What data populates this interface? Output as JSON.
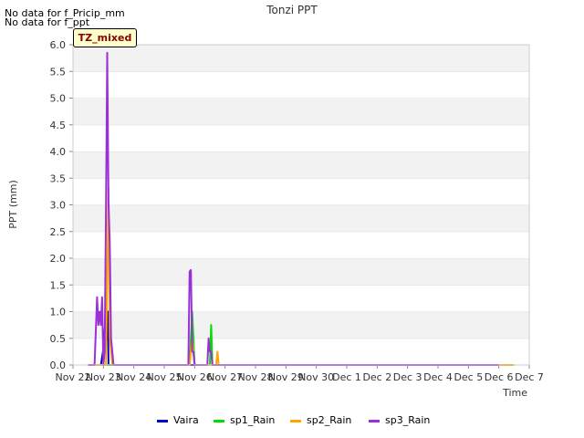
{
  "notes": [
    "No data for f_Pricip_mm",
    "No data for f_ppt"
  ],
  "tz_label": "TZ_mixed",
  "chart_data": {
    "type": "line",
    "title": "Tonzi PPT",
    "xlabel": "Time",
    "ylabel": "PPT (mm)",
    "ylim": [
      0,
      6.0
    ],
    "xlim": [
      "2021-11-22",
      "2021-12-07"
    ],
    "yticks": [
      "0.0",
      "0.5",
      "1.0",
      "1.5",
      "2.0",
      "2.5",
      "3.0",
      "3.5",
      "4.0",
      "4.5",
      "5.0",
      "5.5",
      "6.0"
    ],
    "xticks": [
      "Nov 22",
      "Nov 23",
      "Nov 24",
      "Nov 25",
      "Nov 26",
      "Nov 27",
      "Nov 28",
      "Nov 29",
      "Nov 30",
      "Dec 1",
      "Dec 2",
      "Dec 3",
      "Dec 4",
      "Dec 5",
      "Dec 6",
      "Dec 7"
    ],
    "grid": true,
    "legend_position": "bottom",
    "series": [
      {
        "name": "Vaira",
        "color": "#0000cc",
        "x": [
          "2021-11-22 12:00",
          "2021-11-22 22:00",
          "2021-11-23 00:00",
          "2021-11-23 02:00",
          "2021-11-23 03:00",
          "2021-11-23 03:30",
          "2021-11-23 04:00",
          "2021-11-23 06:00",
          "2021-12-06 00:00"
        ],
        "y": [
          0,
          0,
          0.3,
          1.0,
          0.5,
          1.0,
          0,
          0,
          0
        ]
      },
      {
        "name": "sp1_Rain",
        "color": "#00dd00",
        "x": [
          "2021-11-22 12:00",
          "2021-11-25 20:00",
          "2021-11-25 21:00",
          "2021-11-25 22:00",
          "2021-11-26 00:00",
          "2021-11-26 12:00",
          "2021-11-26 13:00",
          "2021-11-26 14:00",
          "2021-12-06 00:00"
        ],
        "y": [
          0,
          0,
          0.5,
          1.0,
          0,
          0,
          0.75,
          0,
          0
        ]
      },
      {
        "name": "sp2_Rain",
        "color": "#ffa500",
        "x": [
          "2021-11-22 12:00",
          "2021-11-23 02:00",
          "2021-11-23 03:00",
          "2021-11-23 04:00",
          "2021-11-23 05:00",
          "2021-11-23 06:00",
          "2021-11-23 07:00",
          "2021-11-25 20:00",
          "2021-11-25 22:00",
          "2021-11-26 00:00",
          "2021-11-26 17:00",
          "2021-11-26 18:00",
          "2021-11-26 19:00",
          "2021-12-06 12:00"
        ],
        "y": [
          0,
          0,
          1.75,
          3.3,
          0.5,
          0.25,
          0,
          0,
          0.5,
          0,
          0,
          0.25,
          0,
          0
        ]
      },
      {
        "name": "sp3_Rain",
        "color": "#9b30d9",
        "x": [
          "2021-11-22 12:00",
          "2021-11-22 17:00",
          "2021-11-22 19:00",
          "2021-11-22 20:00",
          "2021-11-22 21:00",
          "2021-11-22 22:00",
          "2021-11-22 23:00",
          "2021-11-23 00:00",
          "2021-11-23 01:00",
          "2021-11-23 02:00",
          "2021-11-23 03:00",
          "2021-11-23 04:00",
          "2021-11-23 05:00",
          "2021-11-23 06:00",
          "2021-11-23 07:00",
          "2021-11-23 08:00",
          "2021-11-25 19:00",
          "2021-11-25 20:00",
          "2021-11-25 21:00",
          "2021-11-25 22:00",
          "2021-11-25 23:00",
          "2021-11-26 00:00",
          "2021-11-26 10:00",
          "2021-11-26 11:00",
          "2021-11-26 12:00",
          "2021-11-26 13:00",
          "2021-11-26 14:00",
          "2021-12-06 00:00"
        ],
        "y": [
          0,
          0,
          1.27,
          0.75,
          1.0,
          0.75,
          1.27,
          0,
          0.25,
          2.8,
          5.85,
          3.05,
          2.27,
          0.5,
          0.25,
          0,
          0,
          1.75,
          1.78,
          0.25,
          0.25,
          0,
          0,
          0.5,
          0.25,
          0.25,
          0,
          0
        ]
      }
    ]
  }
}
